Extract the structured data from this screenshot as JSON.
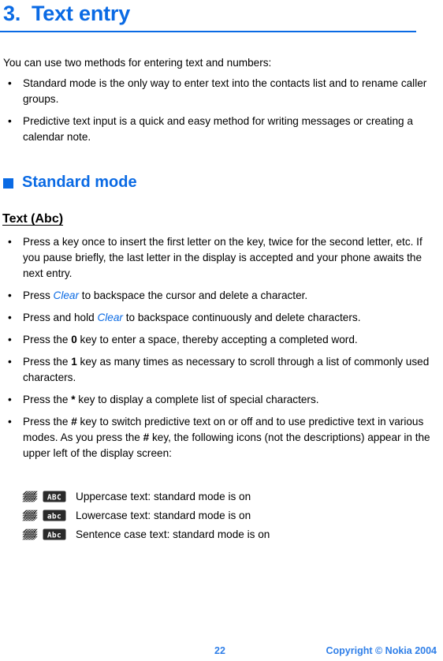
{
  "document": {
    "chapter_number": "3.",
    "chapter_title": "Text entry",
    "intro": "You can use two methods for entering text and numbers:",
    "intro_bullets": [
      "Standard mode is the only way to enter text into the contacts list and to rename caller groups.",
      "Predictive text input is a quick and easy method for writing messages or creating a calendar note."
    ],
    "section_heading": "Standard mode",
    "sub_heading": "Text (Abc)",
    "bullets": [
      {
        "pre": "Press a key once to insert the first letter on the key, twice for the second letter, etc. If you pause briefly, the last letter in the display is accepted and your phone awaits the next entry.",
        "em": "",
        "post": ""
      },
      {
        "pre": "Press ",
        "em": "Clear",
        "post": " to backspace the cursor and delete a character."
      },
      {
        "pre": "Press and hold ",
        "em": "Clear",
        "post": " to backspace continuously and delete characters."
      },
      {
        "pre": "Press the ",
        "key": "0",
        "post": " key to enter a space, thereby accepting a completed word."
      },
      {
        "pre": "Press the ",
        "key": "1",
        "post": " key as many times as necessary to scroll through a list of commonly used characters."
      },
      {
        "pre": "Press the ",
        "key": "*",
        "post": " key to display a complete list of special characters."
      },
      {
        "pre": "Press the ",
        "key": "#",
        "post": " key to switch predictive text on or off and to use predictive text in various modes. As you press the ",
        "key2": "#",
        "post2": " key, the following icons (not the descriptions) appear in the upper left of the display screen:"
      }
    ],
    "icon_rows": [
      {
        "indicator_icon": "sheet-stack-icon",
        "badge_icon": "uppercase-abc-badge-icon",
        "badge_text": "ABC",
        "description": "Uppercase text: standard mode is on"
      },
      {
        "indicator_icon": "sheet-stack-icon",
        "badge_icon": "lowercase-abc-badge-icon",
        "badge_text": "abc",
        "description": "Lowercase text: standard mode is on"
      },
      {
        "indicator_icon": "sheet-stack-icon",
        "badge_icon": "sentencecase-abc-badge-icon",
        "badge_text": "Abc",
        "description": "Sentence case text: standard mode is on"
      }
    ],
    "footer": {
      "page_number": "22",
      "copyright": "Copyright © Nokia 2004"
    },
    "colors": {
      "accent_blue": "#0a6ae4",
      "footer_blue": "#2f7fe8",
      "text_black": "#000000"
    }
  }
}
